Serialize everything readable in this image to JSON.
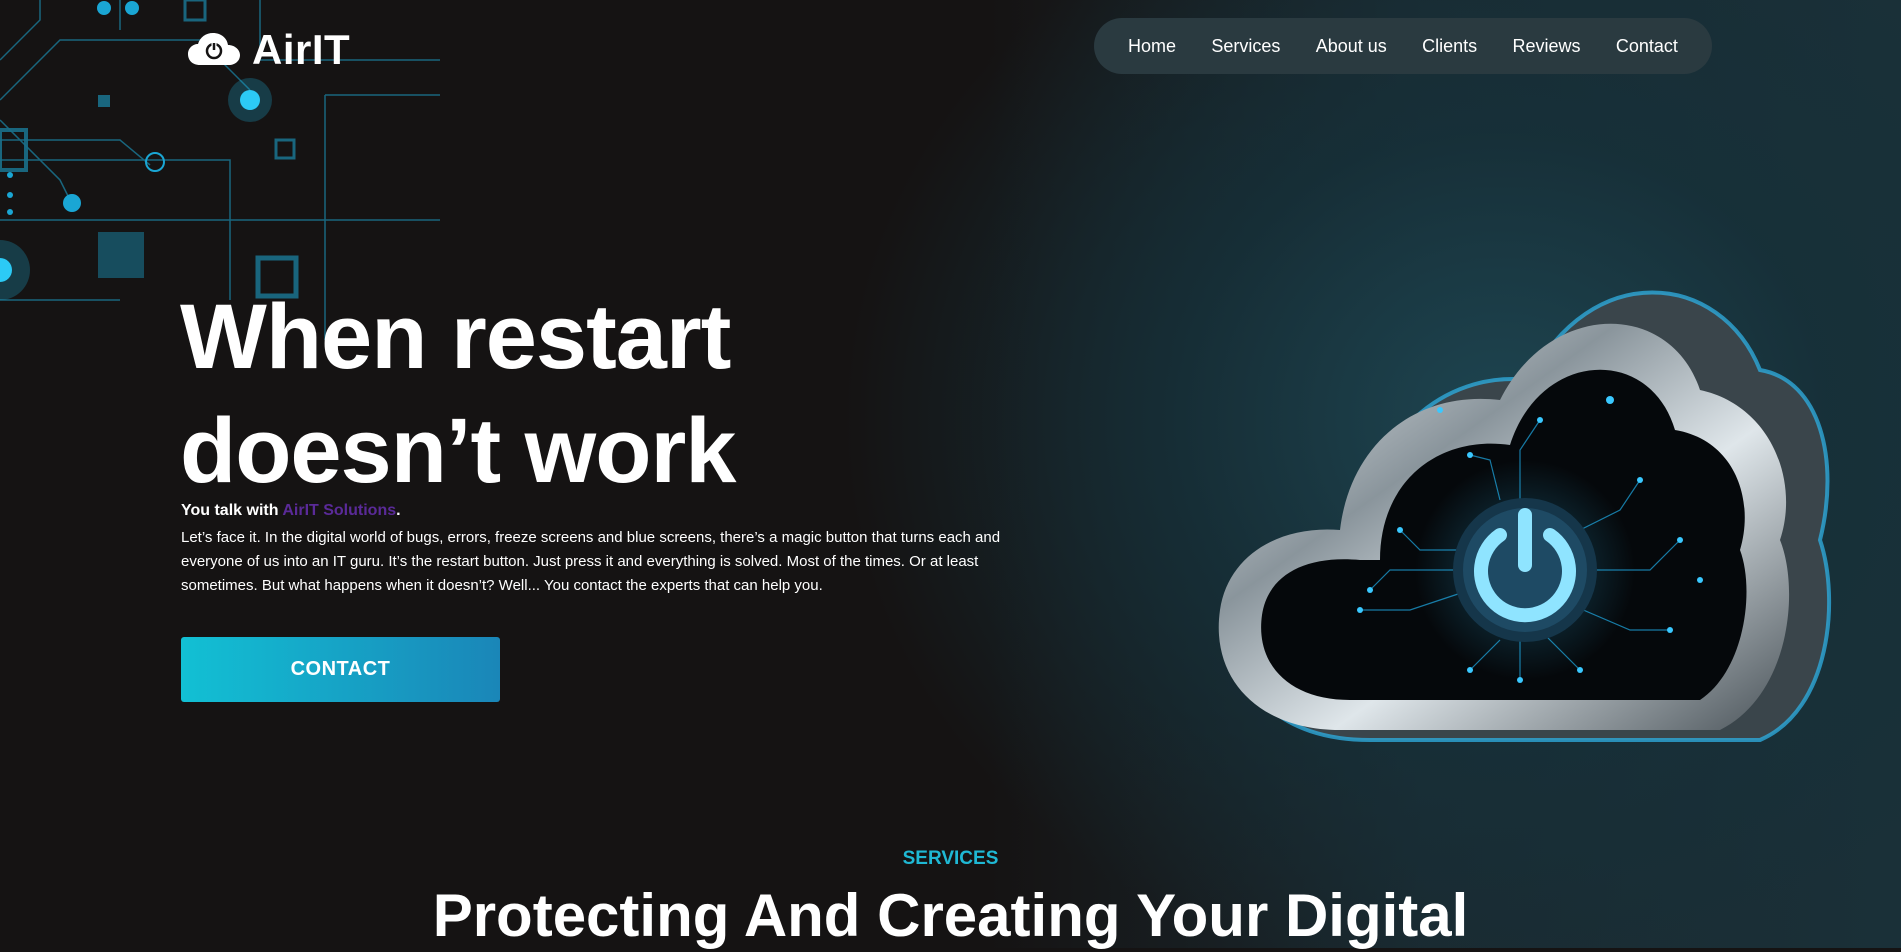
{
  "header": {
    "logo_text": "AirIT",
    "nav": [
      "Home",
      "Services",
      "About us",
      "Clients",
      "Reviews",
      "Contact"
    ]
  },
  "hero": {
    "title_line1": "When restart",
    "title_line2": "doesn’t work",
    "tagline_prefix": "You talk with ",
    "tagline_brand": "AirIT Solutions",
    "tagline_suffix": ".",
    "description": "Let’s face it. In the digital world of bugs, errors, freeze screens and blue screens, there’s a magic button that turns each and everyone of us into an IT guru. It’s the restart button. Just press it and everything is solved. Most of the times. Or at least sometimes. But what happens when it doesn’t? Well... You contact the experts that can help you.",
    "cta_label": "CONTACT"
  },
  "services": {
    "label": "SERVICES",
    "title": "Protecting And Creating Your Digital"
  },
  "colors": {
    "accent_cyan": "#1fb8d4",
    "brand_purple": "#5a2a98",
    "nav_bg": "#2a3a40",
    "page_bg": "#151313"
  },
  "icons": {
    "logo": "cloud-power-icon",
    "hero_art": "cloud-power-circuit-illustration"
  }
}
